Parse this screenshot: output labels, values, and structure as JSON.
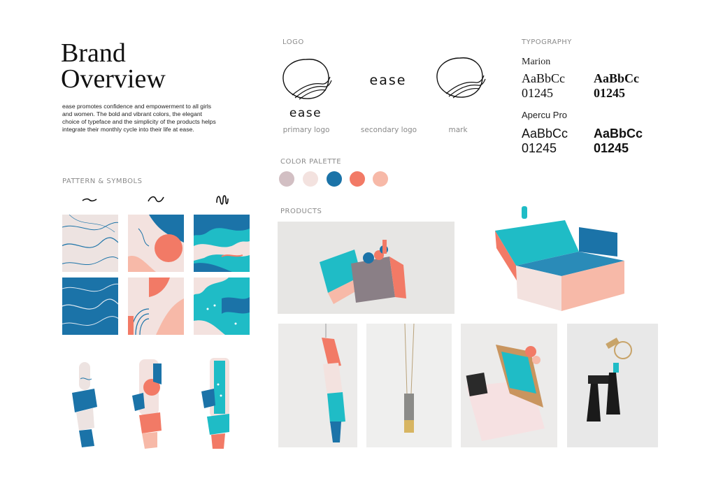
{
  "header": {
    "title_line1": "Brand",
    "title_line2": "Overview",
    "description": "ease promotes confidence and empowerment to all girls and women. The bold and vibrant colors, the elegant choice of typeface and the simplicity of the products helps integrate their monthly cycle into their life at ease."
  },
  "logo": {
    "section_label": "LOGO",
    "wordmark": "ease",
    "primary_caption": "primary logo",
    "secondary_caption": "secondary logo",
    "mark_caption": "mark"
  },
  "typography": {
    "section_label": "TYPOGRAPHY",
    "fonts": [
      {
        "name": "Marion",
        "regular": "AaBbCc",
        "regular_digits": "01245",
        "bold": "AaBbCc",
        "bold_digits": "01245"
      },
      {
        "name": "Apercu Pro",
        "regular": "AaBbCc",
        "regular_digits": "01245",
        "bold": "AaBbCc",
        "bold_digits": "01245"
      }
    ]
  },
  "palette": {
    "section_label": "COLOR PALETTE",
    "colors": [
      "#d2bfc3",
      "#f3e2df",
      "#1b73a8",
      "#f27a66",
      "#f7b9a8"
    ]
  },
  "patterns": {
    "section_label": "PATTERN & SYMBOLS",
    "symbols": [
      "tilde-symbol",
      "wave-symbol",
      "squiggle-symbol"
    ]
  },
  "products": {
    "section_label": "PRODUCTS",
    "items": [
      "wrapped-tampon-boxes",
      "open-gift-box",
      "hanging-wrapped-tampon",
      "pendant-necklace",
      "coin-purse",
      "tassel-keychain"
    ]
  }
}
